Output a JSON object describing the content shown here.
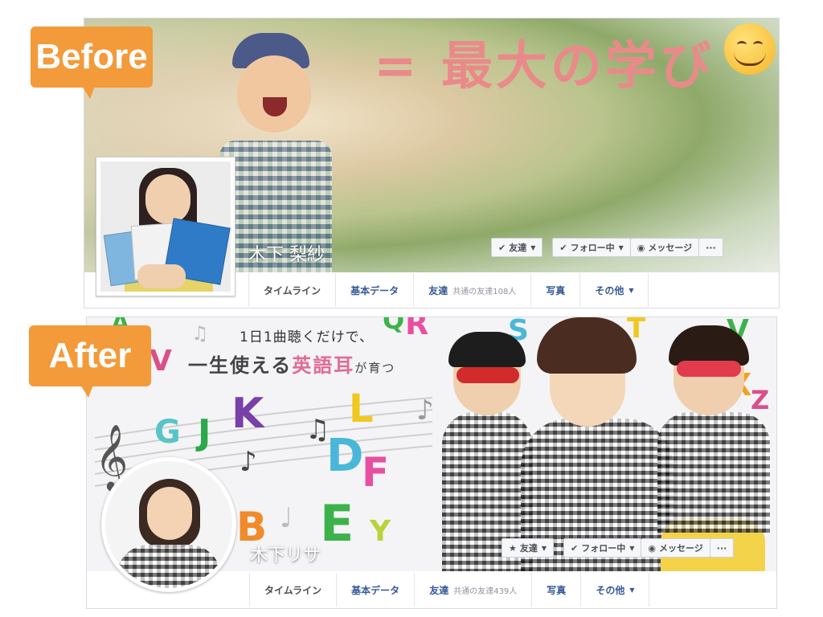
{
  "labels": {
    "before": "Before",
    "after": "After"
  },
  "before": {
    "cover_text": "= 最大の学び",
    "profile_name": "木下 梨紗",
    "actions": {
      "friends": "友達",
      "following": "フォロー中",
      "message": "メッセージ",
      "more": "···"
    },
    "tabs": {
      "timeline": "タイムライン",
      "about": "基本データ",
      "friends": "友達",
      "mutual": "共通の友達108人",
      "photos": "写真",
      "more": "その他"
    }
  },
  "after": {
    "cover_line1": "1日1曲聴くだけで、",
    "cover_line2_part1": "一生使える",
    "cover_line2_part2": "英語耳",
    "cover_line2_part3": "が育つ",
    "profile_name": "木下リサ",
    "actions": {
      "friends": "友達",
      "following": "フォロー中",
      "message": "メッセージ",
      "more": "···"
    },
    "tabs": {
      "timeline": "タイムライン",
      "about": "基本データ",
      "friends": "友達",
      "mutual": "共通の友達439人",
      "photos": "写真",
      "more": "その他"
    },
    "letters": [
      "G",
      "J",
      "K",
      "L",
      "D",
      "F",
      "E",
      "B",
      "Y",
      "A",
      "V",
      "S",
      "R",
      "Q",
      "Z",
      "X",
      "V",
      "T"
    ]
  },
  "colors": {
    "label_orange": "#f39a3a",
    "fb_link": "#365899"
  }
}
